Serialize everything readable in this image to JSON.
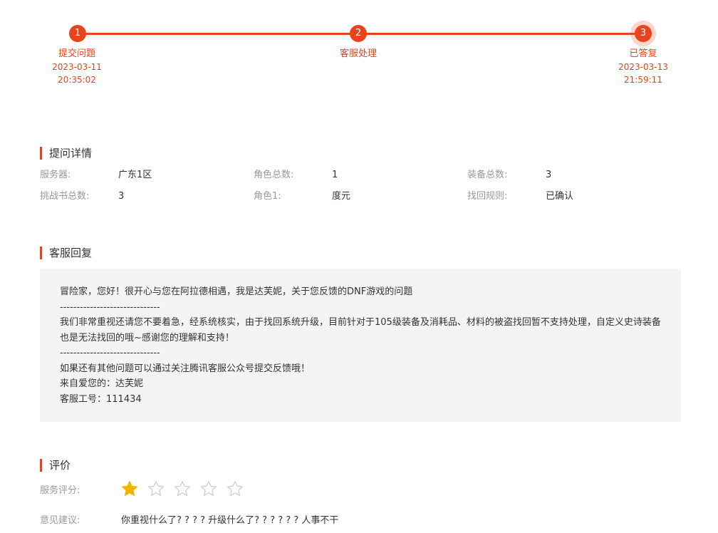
{
  "progress": {
    "steps": [
      {
        "number": "1",
        "label": "提交问题",
        "date": "2023-03-11",
        "time": "20:35:02"
      },
      {
        "number": "2",
        "label": "客服处理",
        "date": "",
        "time": ""
      },
      {
        "number": "3",
        "label": "已答复",
        "date": "2023-03-13",
        "time": "21:59:11"
      }
    ],
    "accent_color": "#e8431c"
  },
  "details": {
    "title": "提问详情",
    "rows": [
      [
        {
          "key": "服务器:",
          "value": "广东1区"
        },
        {
          "key": "角色总数:",
          "value": "1"
        },
        {
          "key": "装备总数:",
          "value": "3"
        }
      ],
      [
        {
          "key": "挑战书总数:",
          "value": "3"
        },
        {
          "key": "角色1:",
          "value": "度元"
        },
        {
          "key": "找回规则:",
          "value": "已确认"
        }
      ]
    ]
  },
  "reply": {
    "title": "客服回复",
    "lines": [
      "冒险家，您好！很开心与您在阿拉德相遇，我是达芙妮，关于您反馈的DNF游戏的问题",
      "------------------------------",
      "我们非常重视还请您不要着急，经系统核实，由于找回系统升级，目前针对于105级装备及消耗品、材料的被盗找回暂不支持处理，自定义史诗装备也是无法找回的哦~感谢您的理解和支持！",
      "------------------------------",
      "如果还有其他问题可以通过关注腾讯客服公众号提交反馈哦！",
      "来自爱您的：达芙妮",
      "客服工号：111434"
    ]
  },
  "rating": {
    "title": "评价",
    "score_label": "服务评分:",
    "score": 1,
    "max_score": 5,
    "star_filled_color": "#f5b301",
    "star_empty_color": "#cccccc",
    "suggestion_label": "意见建议:",
    "suggestion": "你重视什么了? ? ? ? 升级什么了? ? ? ? ? ? 人事不干"
  }
}
